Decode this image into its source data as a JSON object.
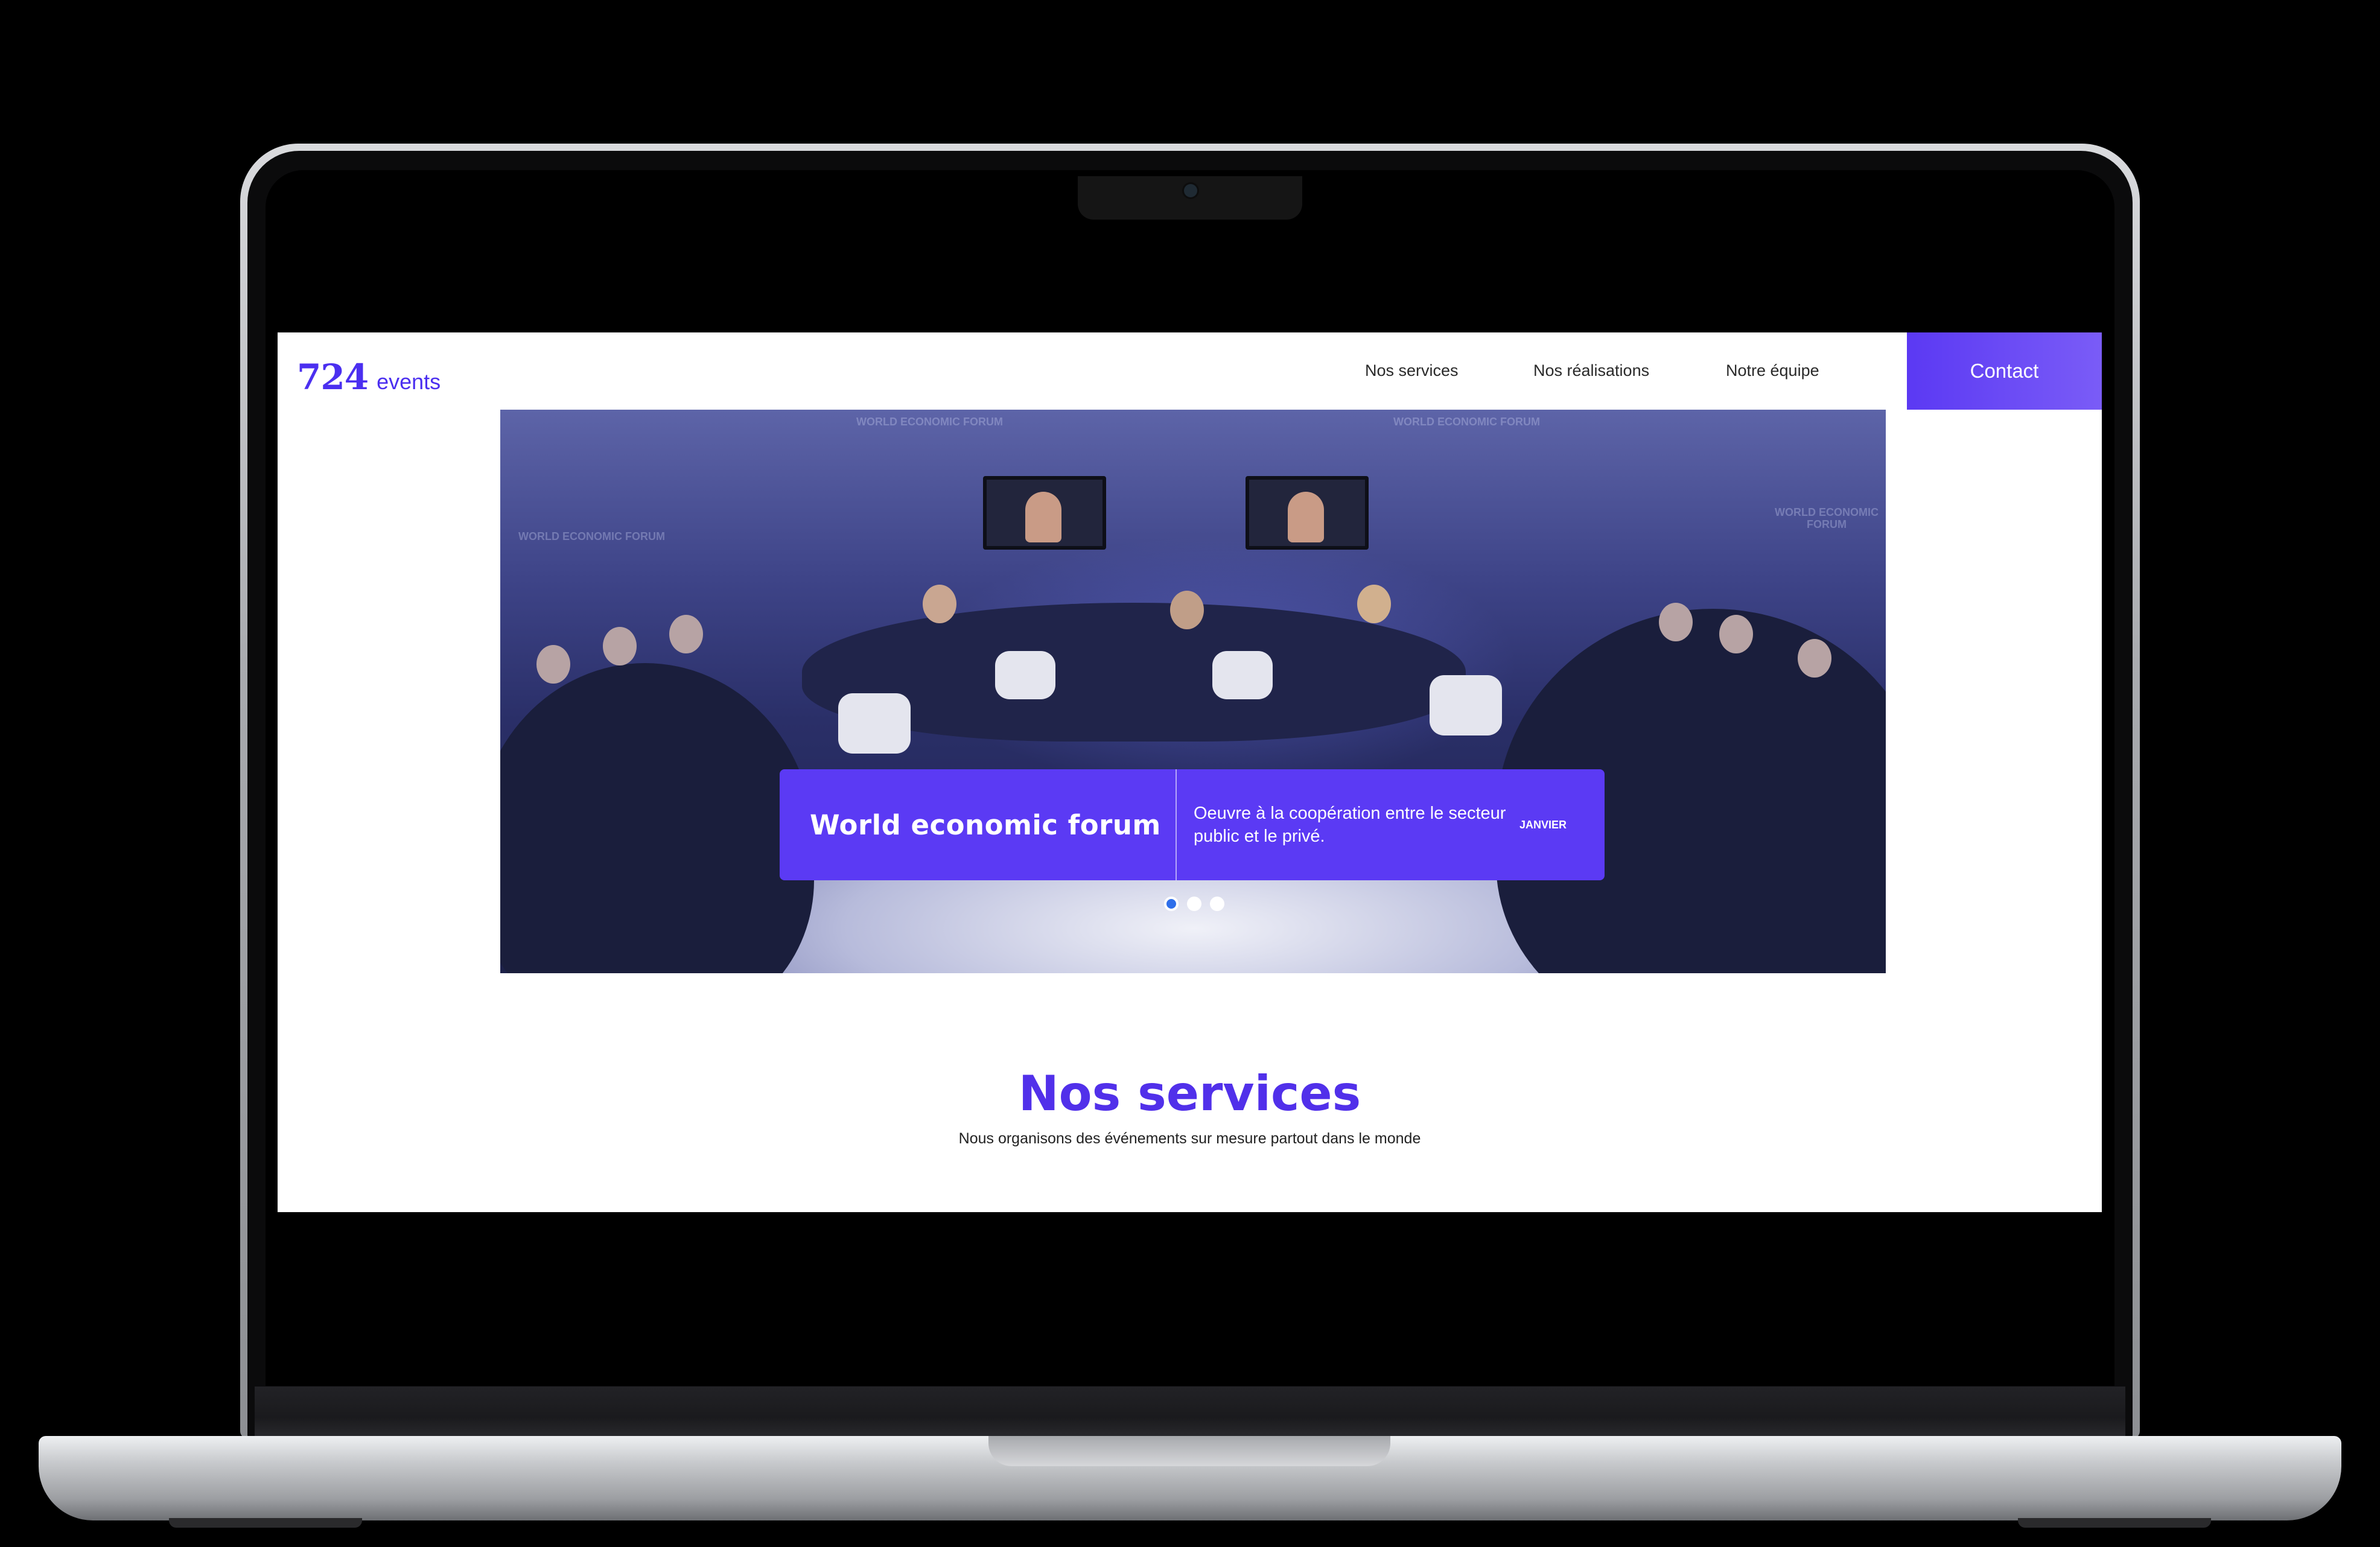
{
  "site": {
    "logo": {
      "number": "724",
      "text": "events"
    },
    "nav": {
      "items": [
        {
          "label": "Nos services"
        },
        {
          "label": "Nos réalisations"
        },
        {
          "label": "Notre équipe"
        }
      ],
      "contact_label": "Contact"
    },
    "hero": {
      "card": {
        "title": "World economic forum",
        "description": "Oeuvre à la coopération entre le secteur public et le privé.",
        "month": "JANVIER"
      },
      "slides_count": 3,
      "active_slide": 1,
      "wall_branding": [
        "WORLD ECONOMIC FORUM"
      ]
    },
    "services": {
      "title": "Nos services",
      "subtitle": "Nous organisons des événements sur mesure partout dans le monde"
    }
  },
  "colors": {
    "accent": "#5b3af4",
    "accent_light": "#7a5cf7",
    "title": "#5130ea",
    "active_dot": "#2f6fea"
  },
  "icons": {
    "camera": "camera-icon"
  }
}
